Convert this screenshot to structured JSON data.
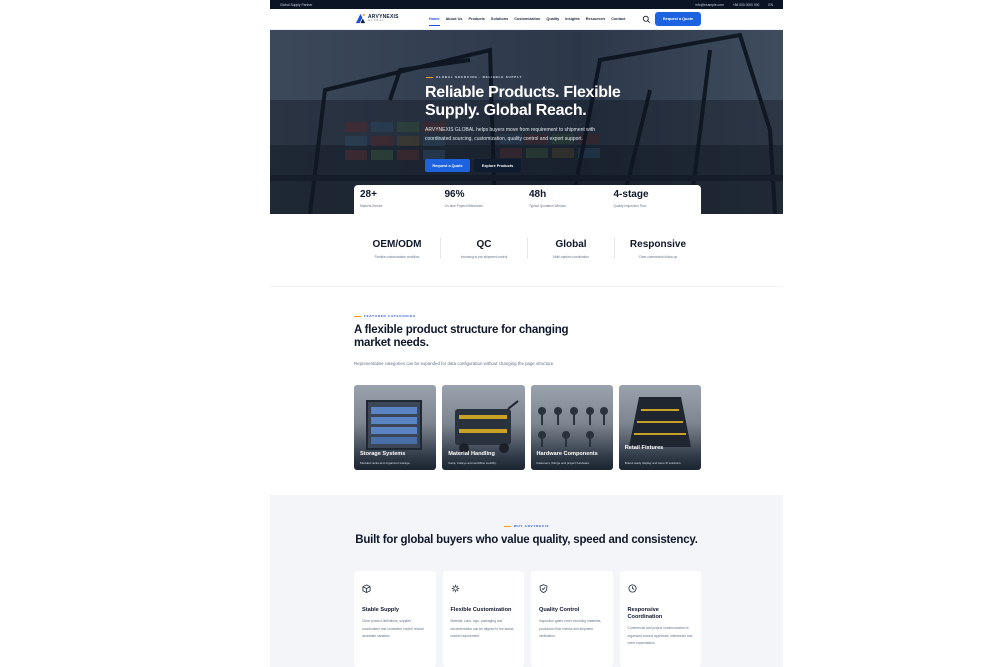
{
  "topbar": {
    "left": "Global Supply Partner",
    "email": "info@example.com",
    "phone": "+86 000 0000 000",
    "lang": "EN"
  },
  "header": {
    "logo_name": "ARVYNEXIS",
    "logo_sub": "GLOBAL",
    "nav": [
      "Home",
      "About Us",
      "Products",
      "Solutions",
      "Customization",
      "Quality",
      "Insights",
      "Resources",
      "Contact"
    ],
    "quote_button": "Request a Quote",
    "icons": {
      "search": "search-icon"
    }
  },
  "hero": {
    "eyebrow": "GLOBAL SOURCING · RELIABLE SUPPLY",
    "title": "Reliable Products. Flexible Supply. Global Reach.",
    "description": "ARVYNEXIS GLOBAL helps buyers move from requirement to shipment with coordinated sourcing, customization, quality control and export support.",
    "primary_button": "Request a Quote",
    "secondary_button": "Explore Products"
  },
  "stats": [
    {
      "value": "28+",
      "label": "Markets Served"
    },
    {
      "value": "96%",
      "label": "On-time Project Milestones"
    },
    {
      "value": "48h",
      "label": "Typical Quotation Window"
    },
    {
      "value": "4-stage",
      "label": "Quality Inspection Flow"
    }
  ],
  "capabilities": [
    {
      "value": "OEM/ODM",
      "label": "Flexible customization workflow"
    },
    {
      "value": "QC",
      "label": "Incoming to pre-shipment control"
    },
    {
      "value": "Global",
      "label": "Multi-market coordination"
    },
    {
      "value": "Responsive",
      "label": "Clear commercial follow-up"
    }
  ],
  "featured": {
    "eyebrow": "FEATURED CATEGORIES",
    "title": "A flexible product structure for changing market needs.",
    "description": "Representative categories can be expanded for data configuration without changing the page structure.",
    "cards": [
      {
        "title": "Storage Systems",
        "desc": "Modular racks and organized storage."
      },
      {
        "title": "Material Handling",
        "desc": "Carts, trolleys and workflow mobility."
      },
      {
        "title": "Hardware Components",
        "desc": "Fasteners, fittings and project hardware."
      },
      {
        "title": "Retail Fixtures",
        "desc": "Brand-ready display and store fit solutions."
      }
    ]
  },
  "why": {
    "eyebrow": "WHY ARVYNEXIS",
    "title": "Built for global buyers who value quality, speed and consistency.",
    "cards": [
      {
        "icon": "box-icon",
        "title": "Stable Supply",
        "desc": "Clear product definitions, supplier coordination and consistent control reduce avoidable variation."
      },
      {
        "icon": "gear-icon",
        "title": "Flexible Customization",
        "desc": "Material, color, logo, packaging and documentation can be aligned to the actual market requirement."
      },
      {
        "icon": "shield-check-icon",
        "title": "Quality Control",
        "desc": "Inspection gates cover incoming materials, production flow checks and shipment verification."
      },
      {
        "icon": "clock-icon",
        "title": "Responsive Coordination",
        "desc": "Commercial and project communication is organized around approvals, milestones and order expectations."
      }
    ]
  },
  "colors": {
    "primary": "#1d63e0",
    "accent": "#f59e0b",
    "dark": "#0b1424"
  }
}
